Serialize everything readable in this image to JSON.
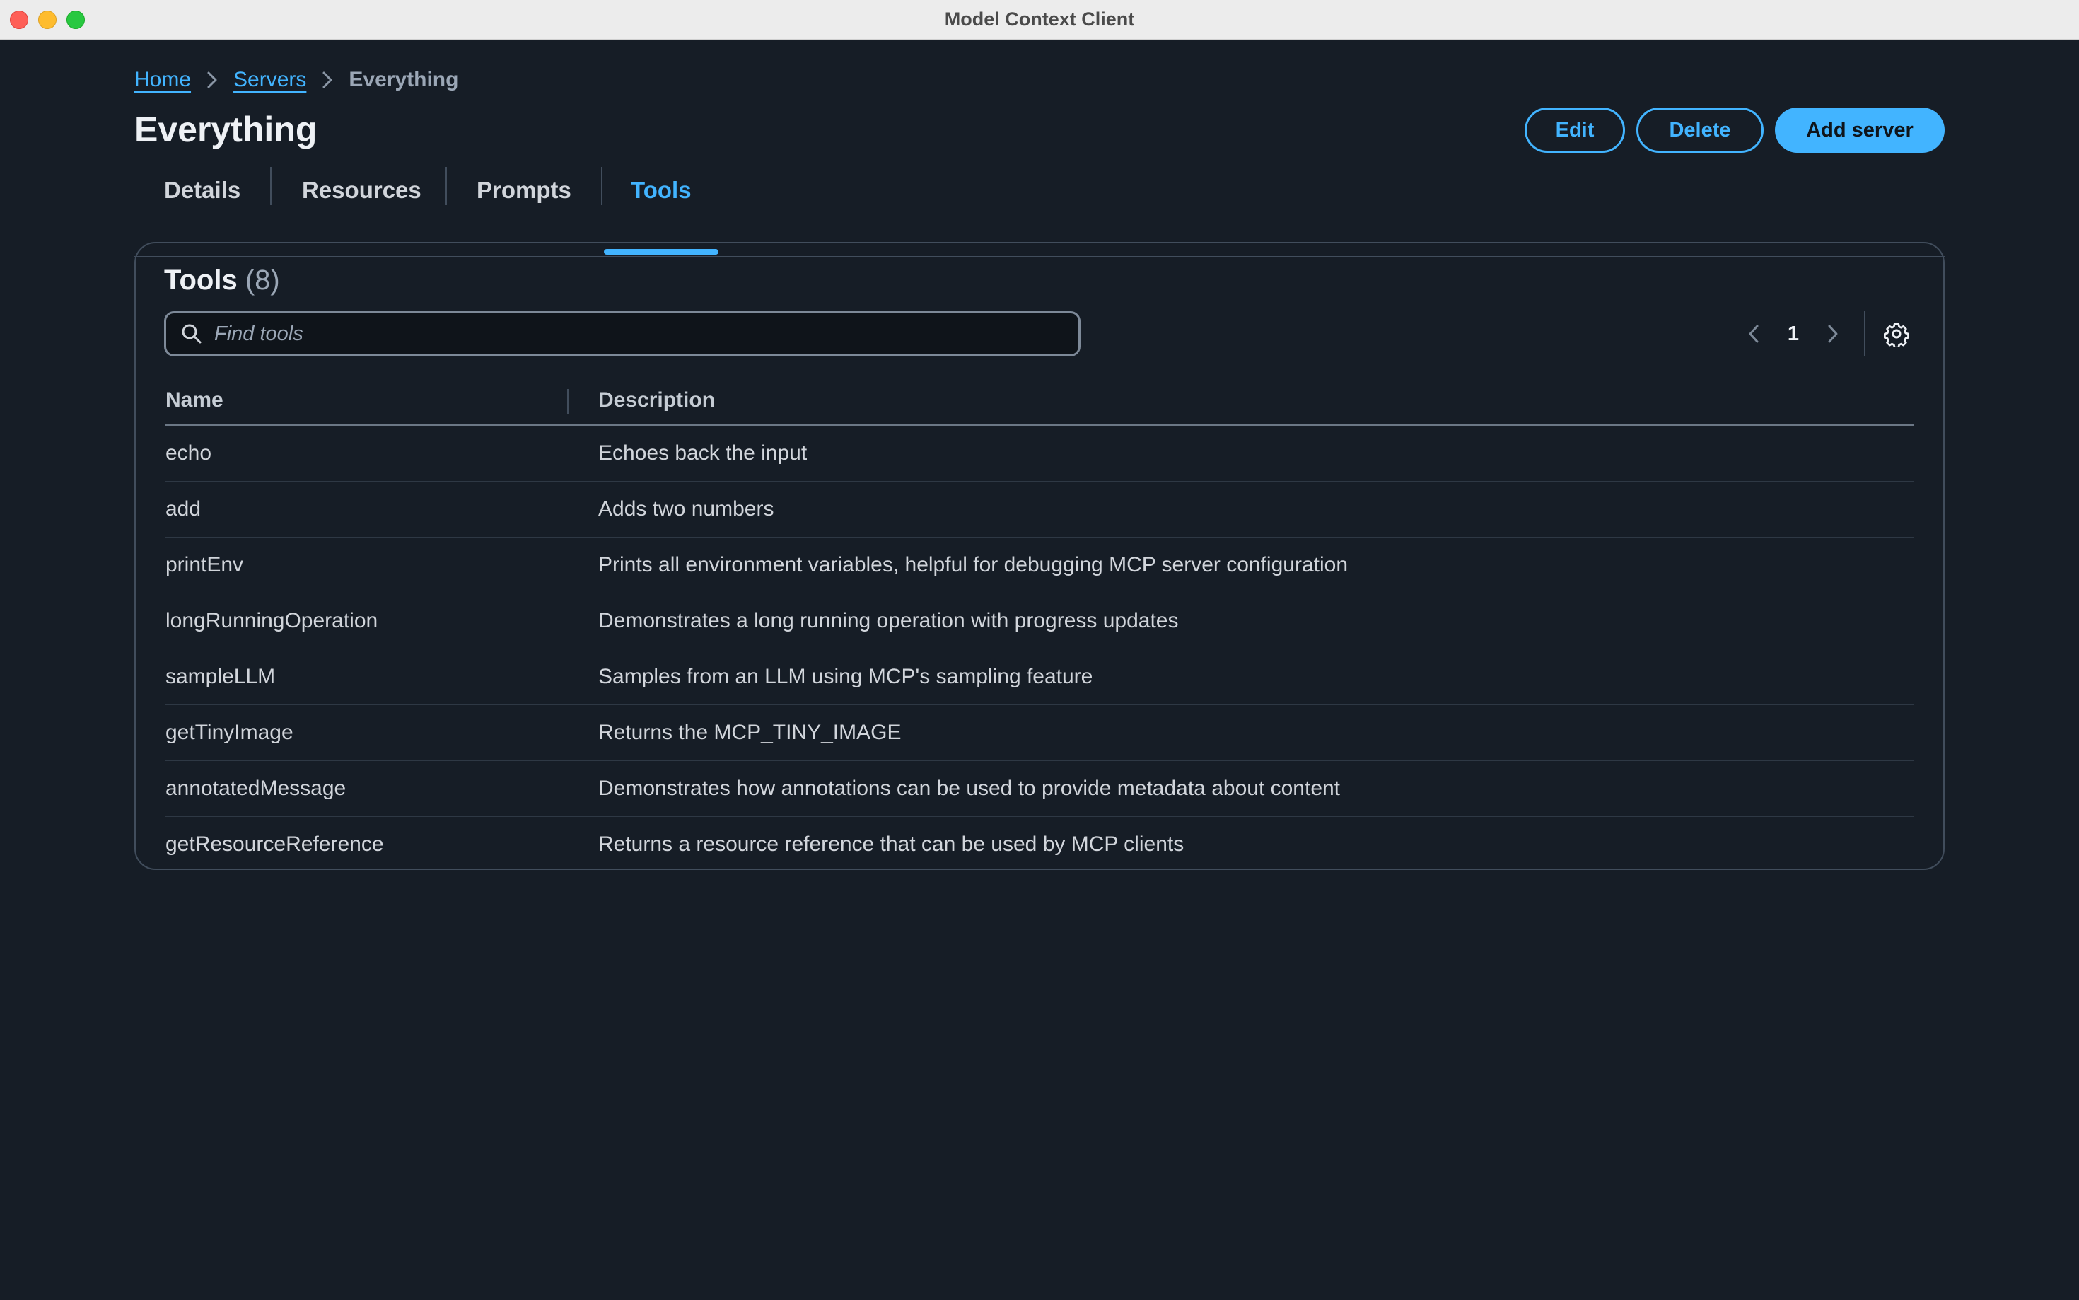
{
  "window": {
    "title": "Model Context Client"
  },
  "breadcrumb": {
    "home": "Home",
    "servers": "Servers",
    "current": "Everything"
  },
  "page": {
    "title": "Everything"
  },
  "actions": {
    "edit": "Edit",
    "delete": "Delete",
    "add_server": "Add server"
  },
  "tabs": [
    {
      "label": "Details"
    },
    {
      "label": "Resources"
    },
    {
      "label": "Prompts"
    },
    {
      "label": "Tools",
      "active": true
    }
  ],
  "tools": {
    "header": "Tools",
    "count": "(8)",
    "search_placeholder": "Find tools",
    "page": "1",
    "columns": {
      "name": "Name",
      "description": "Description"
    },
    "rows": [
      {
        "name": "echo",
        "description": "Echoes back the input"
      },
      {
        "name": "add",
        "description": "Adds two numbers"
      },
      {
        "name": "printEnv",
        "description": "Prints all environment variables, helpful for debugging MCP server configuration"
      },
      {
        "name": "longRunningOperation",
        "description": "Demonstrates a long running operation with progress updates"
      },
      {
        "name": "sampleLLM",
        "description": "Samples from an LLM using MCP's sampling feature"
      },
      {
        "name": "getTinyImage",
        "description": "Returns the MCP_TINY_IMAGE"
      },
      {
        "name": "annotatedMessage",
        "description": "Demonstrates how annotations can be used to provide metadata about content"
      },
      {
        "name": "getResourceReference",
        "description": "Returns a resource reference that can be used by MCP clients"
      }
    ]
  },
  "colors": {
    "accent": "#42b4ff",
    "background": "#161d26",
    "border": "#414d5c"
  }
}
